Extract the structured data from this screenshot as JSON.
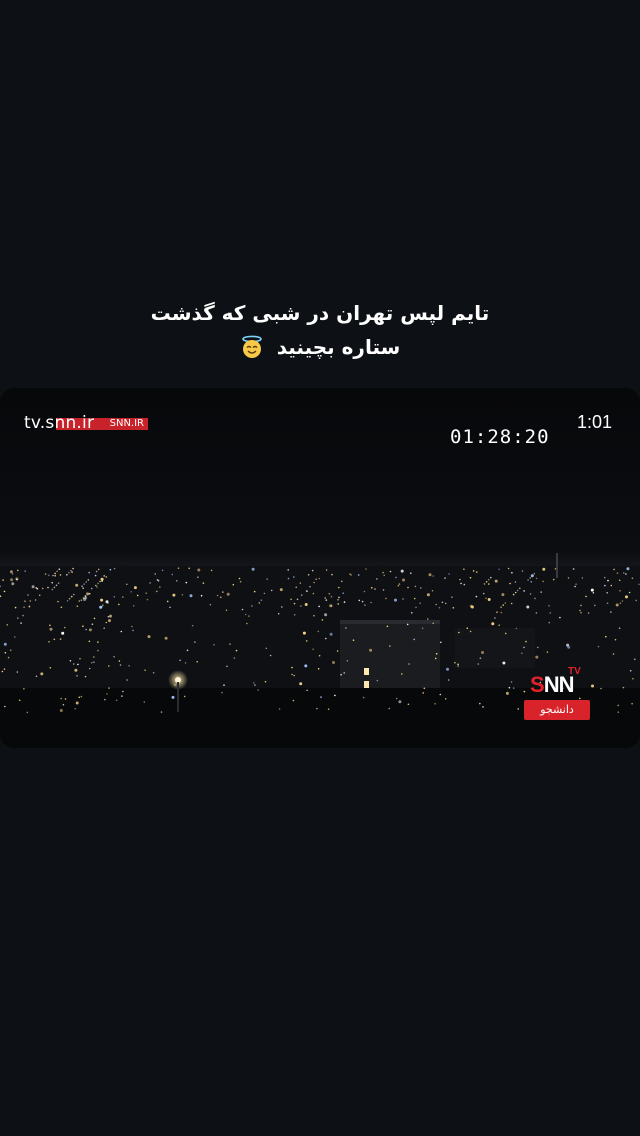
{
  "caption": {
    "line1": "تایم لپس تهران در شبی که گذشت",
    "line2": "ستاره بچینید",
    "emoji_icon": "smiling-face-with-halo-icon"
  },
  "video": {
    "watermark_left": "tv.snn.ir",
    "watermark_left_bar": "SNN.IR",
    "timestamp": "01:28:20",
    "duration": "1:01",
    "logo": {
      "main": "NN",
      "initial": "S",
      "tv": "TV",
      "sub": "دانشجو"
    }
  },
  "colors": {
    "background": "#0d1115",
    "accent_red": "#d8232b",
    "text": "#ffffff"
  }
}
